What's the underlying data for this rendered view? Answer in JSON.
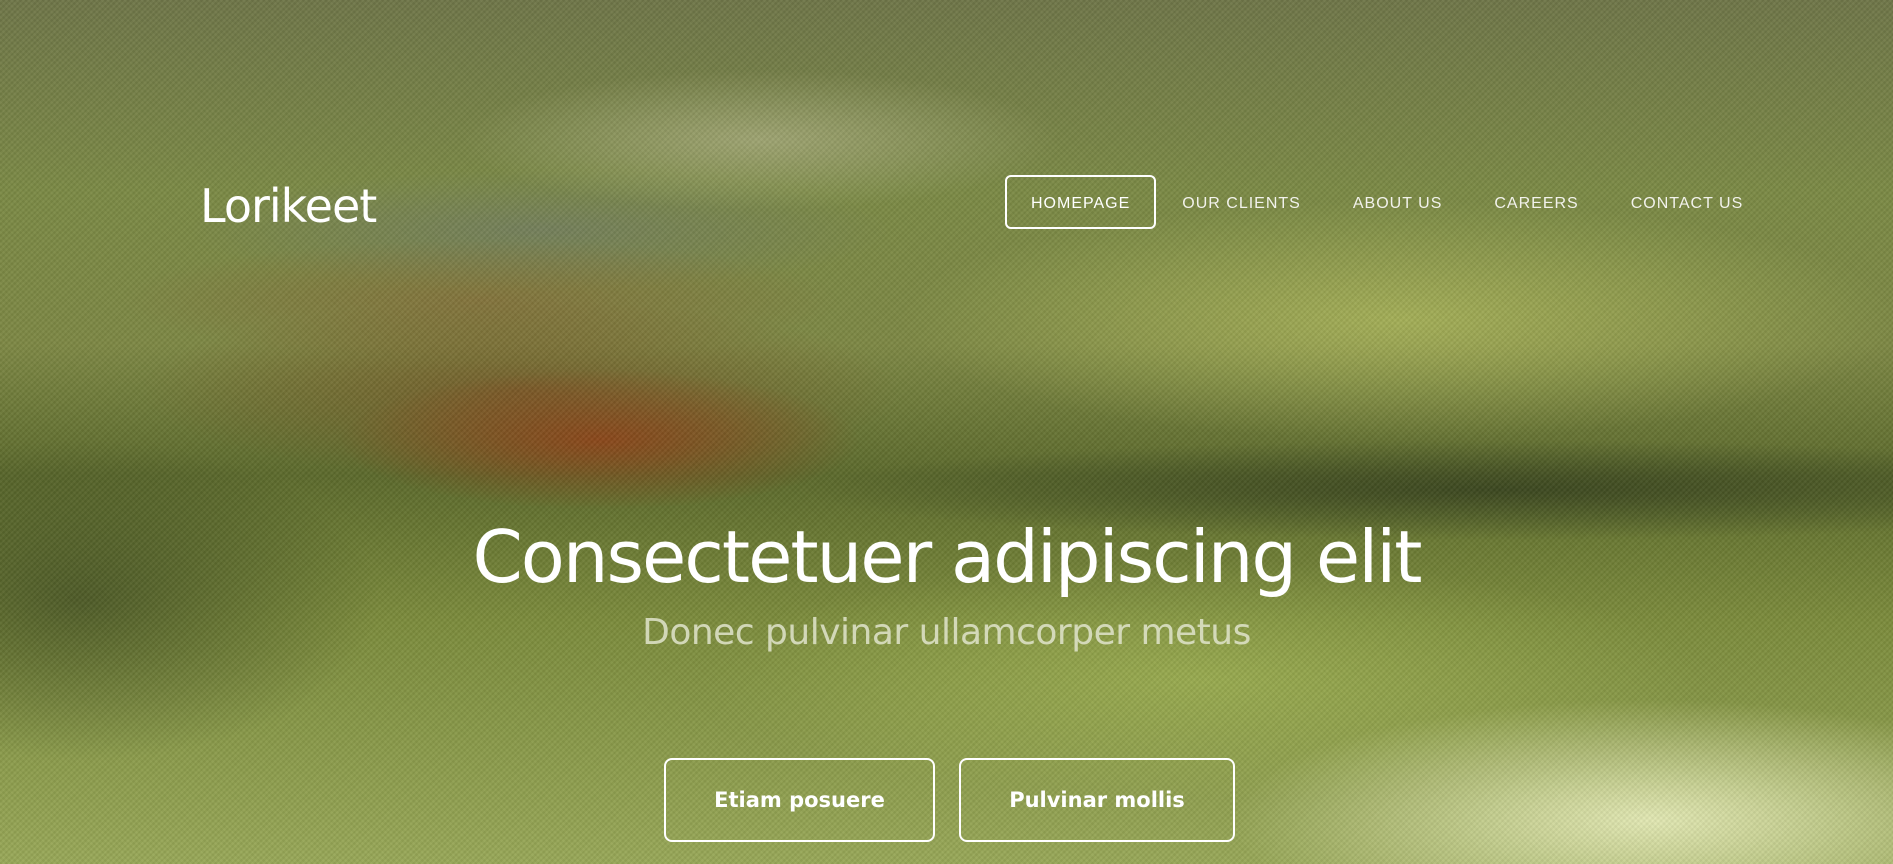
{
  "site": {
    "logo_text": "Lorikeet"
  },
  "nav": {
    "items": [
      {
        "label": "HOMEPAGE",
        "active": true
      },
      {
        "label": "OUR CLIENTS",
        "active": false
      },
      {
        "label": "ABOUT US",
        "active": false
      },
      {
        "label": "CAREERS",
        "active": false
      },
      {
        "label": "CONTACT US",
        "active": false
      }
    ]
  },
  "hero": {
    "title": "Consectetuer adipiscing elit",
    "subtitle": "Donec pulvinar ullamcorper metus",
    "buttons": {
      "primary_label": "Etiam posuere",
      "secondary_label": "Pulvinar mollis"
    }
  },
  "colors": {
    "text": "#ffffff",
    "subtitle": "#e1e4cd",
    "button_border": "#ffffff"
  }
}
